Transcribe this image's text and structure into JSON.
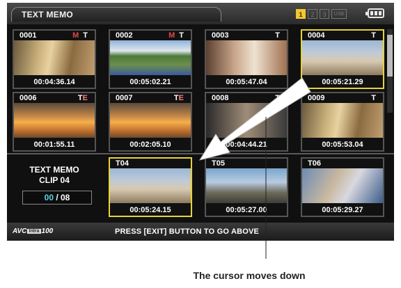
{
  "header": {
    "title": "TEXT MEMO",
    "slots": [
      "1",
      "2",
      "3",
      "USB"
    ],
    "active_slot": "1",
    "battery_icon": "battery-icon"
  },
  "clips": [
    {
      "num": "0001",
      "m": "M",
      "t": "T",
      "e": "",
      "time": "00:04:36.14",
      "image": "street",
      "selected": false
    },
    {
      "num": "0002",
      "m": "M",
      "t": "T",
      "e": "",
      "time": "00:05:02.21",
      "image": "coast",
      "selected": false
    },
    {
      "num": "0003",
      "m": "",
      "t": "T",
      "e": "",
      "time": "00:05:47.04",
      "image": "room",
      "selected": false
    },
    {
      "num": "0004",
      "m": "",
      "t": "T",
      "e": "",
      "time": "00:05:21.29",
      "image": "villa",
      "selected": true
    },
    {
      "num": "0006",
      "m": "",
      "t": "T",
      "e": "E",
      "time": "00:01:55.11",
      "image": "sunset",
      "selected": false
    },
    {
      "num": "0007",
      "m": "",
      "t": "T",
      "e": "E",
      "time": "00:02:05.10",
      "image": "sunset",
      "selected": false
    },
    {
      "num": "0008",
      "m": "",
      "t": "T",
      "e": "",
      "time": "00:04:44.21",
      "image": "dark",
      "selected": false
    },
    {
      "num": "0009",
      "m": "",
      "t": "T",
      "e": "",
      "time": "00:05:53.04",
      "image": "street",
      "selected": false
    }
  ],
  "memo_panel": {
    "title_line1": "TEXT MEMO",
    "title_line2": "CLIP 04",
    "current": "00",
    "total": "/ 08"
  },
  "memos": [
    {
      "label": "T04",
      "time": "00:05:24.15",
      "image": "villa",
      "selected": true
    },
    {
      "label": "T05",
      "time": "00:05:27.00",
      "image": "sky",
      "selected": false
    },
    {
      "label": "T06",
      "time": "00:05:29.27",
      "image": "blue",
      "selected": false
    }
  ],
  "footer": {
    "logo_prefix": "AVC",
    "logo_box": "Intra",
    "logo_suffix": "100",
    "message": "PRESS [EXIT] BUTTON TO GO ABOVE"
  },
  "annotation": {
    "caption": "The cursor moves down"
  },
  "colors": {
    "selection": "#e8d23a",
    "slot_active": "#f2c82f",
    "counter_current": "#52d6e8"
  }
}
